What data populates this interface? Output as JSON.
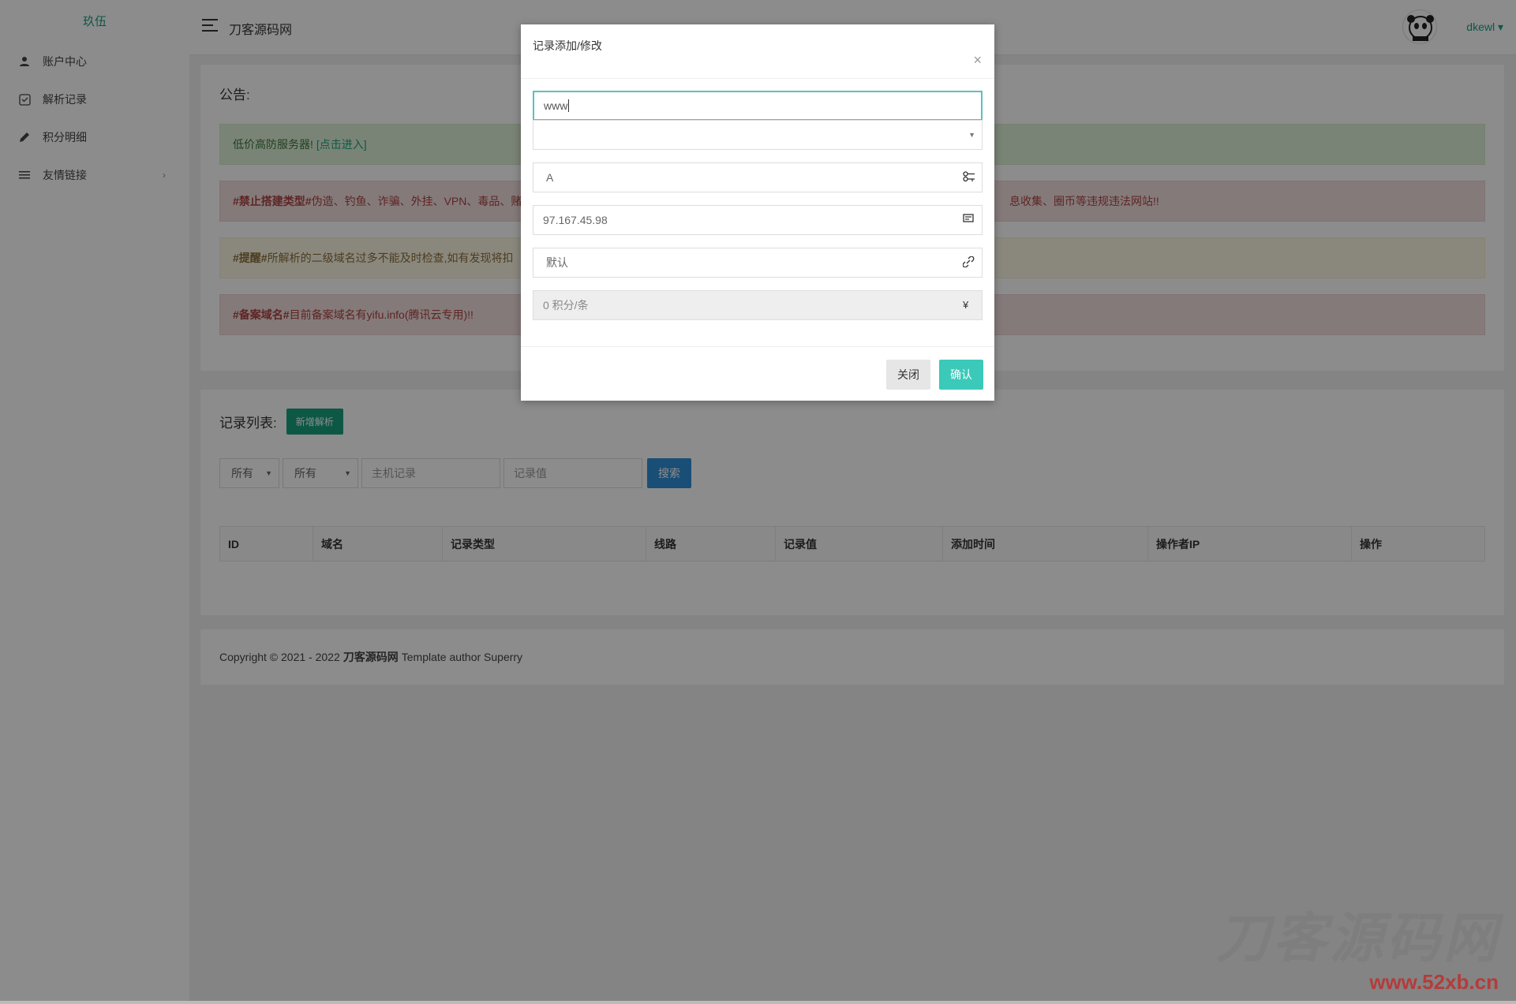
{
  "sidebar": {
    "logo_alt": "玖伍",
    "items": [
      {
        "label": "账户中心",
        "icon": "user-icon"
      },
      {
        "label": "解析记录",
        "icon": "record-icon"
      },
      {
        "label": "积分明细",
        "icon": "pencil-icon"
      },
      {
        "label": "友情链接",
        "icon": "list-icon",
        "arrow": "›"
      }
    ]
  },
  "header": {
    "site_name": "刀客源码网",
    "user_name": "dkewl ▾"
  },
  "notice": {
    "title": "公告:",
    "success": {
      "text": "低价高防服务器!",
      "link": "[点击进入]"
    },
    "danger1": {
      "tag": "#禁止搭建类型#",
      "text": " 伪造、钓鱼、诈骗、外挂、VPN、毒品、赌",
      "right": "息收集、圈币等违规违法网站!!"
    },
    "warning": {
      "tag": "#提醒#",
      "text": " 所解析的二级域名过多不能及时检查,如有发现将扣"
    },
    "danger2": {
      "tag": "#备案域名#",
      "text": " 目前备案域名有yifu.info(腾讯云专用)!!"
    }
  },
  "records": {
    "title": "记录列表:",
    "add_button": "新增解析",
    "filter1": "所有",
    "filter2": "所有",
    "host_placeholder": "主机记录",
    "value_placeholder": "记录值",
    "search_button": "搜索",
    "columns": [
      "ID",
      "域名",
      "记录类型",
      "线路",
      "记录值",
      "添加时间",
      "操作者IP",
      "操作"
    ]
  },
  "footer": {
    "prefix": "Copyright © 2021 - 2022",
    "brand": "刀客源码网",
    "suffix": "Template author Superry"
  },
  "modal": {
    "title": "记录添加/修改",
    "close_x": "×",
    "host_value": "www",
    "domain_value": "",
    "type_value": "A",
    "record_value": "97.167.45.98",
    "line_value": "默认",
    "cost_value": "0 积分/条",
    "cost_icon": "¥",
    "close_button": "关闭",
    "confirm_button": "确认"
  },
  "watermark": {
    "text": "刀客源码网",
    "url": "www.52xb.cn"
  }
}
